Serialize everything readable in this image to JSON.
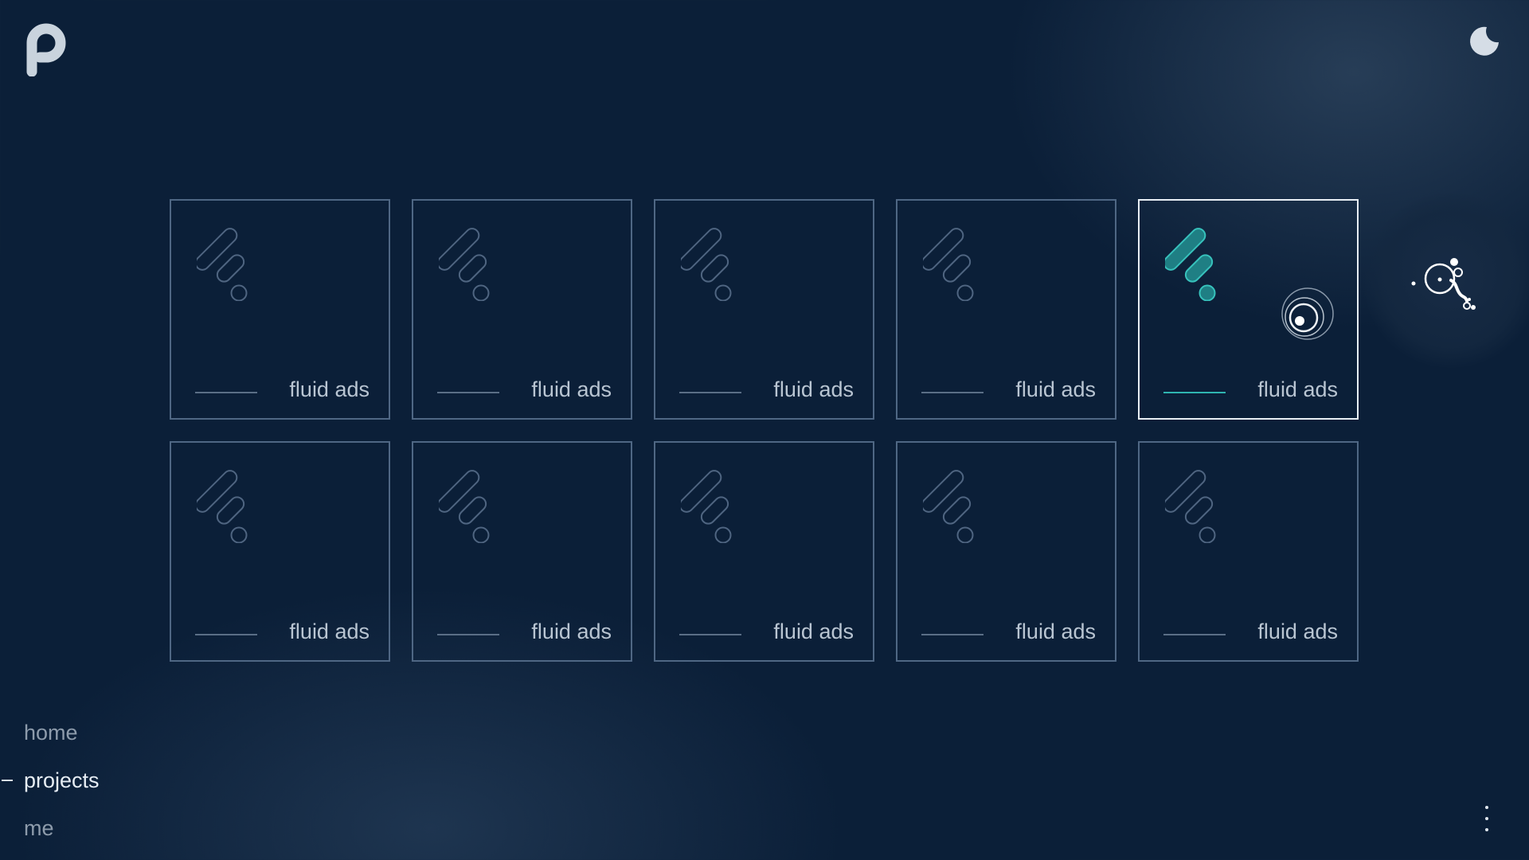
{
  "header": {
    "logo_icon": "p-logo-icon",
    "theme_toggle_icon": "moon-icon"
  },
  "projects": [
    {
      "title": "fluid ads",
      "icon": "fluid-ads-icon",
      "active": false
    },
    {
      "title": "fluid ads",
      "icon": "fluid-ads-icon",
      "active": false
    },
    {
      "title": "fluid ads",
      "icon": "fluid-ads-icon",
      "active": false
    },
    {
      "title": "fluid ads",
      "icon": "fluid-ads-icon",
      "active": false
    },
    {
      "title": "fluid ads",
      "icon": "fluid-ads-icon",
      "active": true
    },
    {
      "title": "fluid ads",
      "icon": "fluid-ads-icon",
      "active": false
    },
    {
      "title": "fluid ads",
      "icon": "fluid-ads-icon",
      "active": false
    },
    {
      "title": "fluid ads",
      "icon": "fluid-ads-icon",
      "active": false
    },
    {
      "title": "fluid ads",
      "icon": "fluid-ads-icon",
      "active": false
    },
    {
      "title": "fluid ads",
      "icon": "fluid-ads-icon",
      "active": false
    }
  ],
  "nav": {
    "items": [
      {
        "label": "home",
        "active": false
      },
      {
        "label": "projects",
        "active": true
      },
      {
        "label": "me",
        "active": false
      }
    ]
  },
  "footer": {
    "more_icon": "more-vertical-icon"
  },
  "colors": {
    "background": "#0b1f38",
    "card_border": "#4f6784",
    "card_border_active": "#e8eef4",
    "accent": "#2fb4b0",
    "text_muted": "#8d9bab",
    "text_active": "#e6edf4"
  }
}
